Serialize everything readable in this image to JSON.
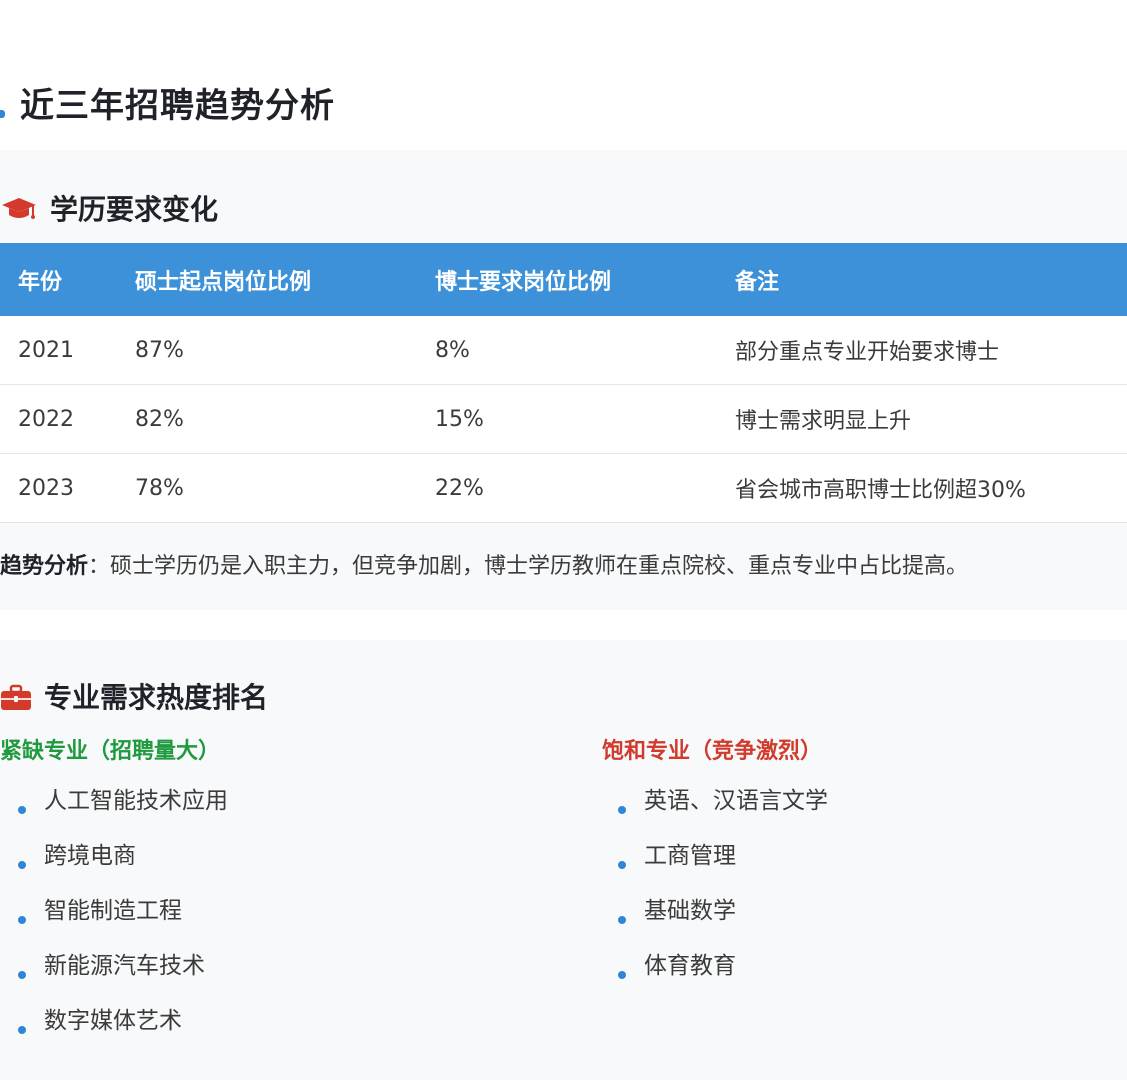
{
  "page_title": "近三年招聘趋势分析",
  "edu_section": {
    "title": "学历要求变化",
    "icon": "graduation-cap-icon",
    "table": {
      "headers": [
        "年份",
        "硕士起点岗位比例",
        "博士要求岗位比例",
        "备注"
      ],
      "rows": [
        [
          "2021",
          "87%",
          "8%",
          "部分重点专业开始要求博士"
        ],
        [
          "2022",
          "82%",
          "15%",
          "博士需求明显上升"
        ],
        [
          "2023",
          "78%",
          "22%",
          "省会城市高职博士比例超30%"
        ]
      ]
    },
    "trend_label": "趋势分析",
    "trend_colon": "：",
    "trend_text": "硕士学历仍是入职主力，但竞争加剧，博士学历教师在重点院校、重点专业中占比提高。"
  },
  "major_section": {
    "title": "专业需求热度排名",
    "icon": "briefcase-icon",
    "shortage": {
      "title": "紧缺专业（招聘量大）",
      "color": "#1f9a3e",
      "items": [
        "人工智能技术应用",
        "跨境电商",
        "智能制造工程",
        "新能源汽车技术",
        "数字媒体艺术"
      ]
    },
    "saturated": {
      "title": "饱和专业（竞争激烈）",
      "color": "#d23a2c",
      "items": [
        "英语、汉语言文学",
        "工商管理",
        "基础数学",
        "体育教育"
      ]
    }
  },
  "colors": {
    "table_header": "#3d91d8",
    "accent": "#2f86d6",
    "icon_red": "#d33a2c"
  }
}
